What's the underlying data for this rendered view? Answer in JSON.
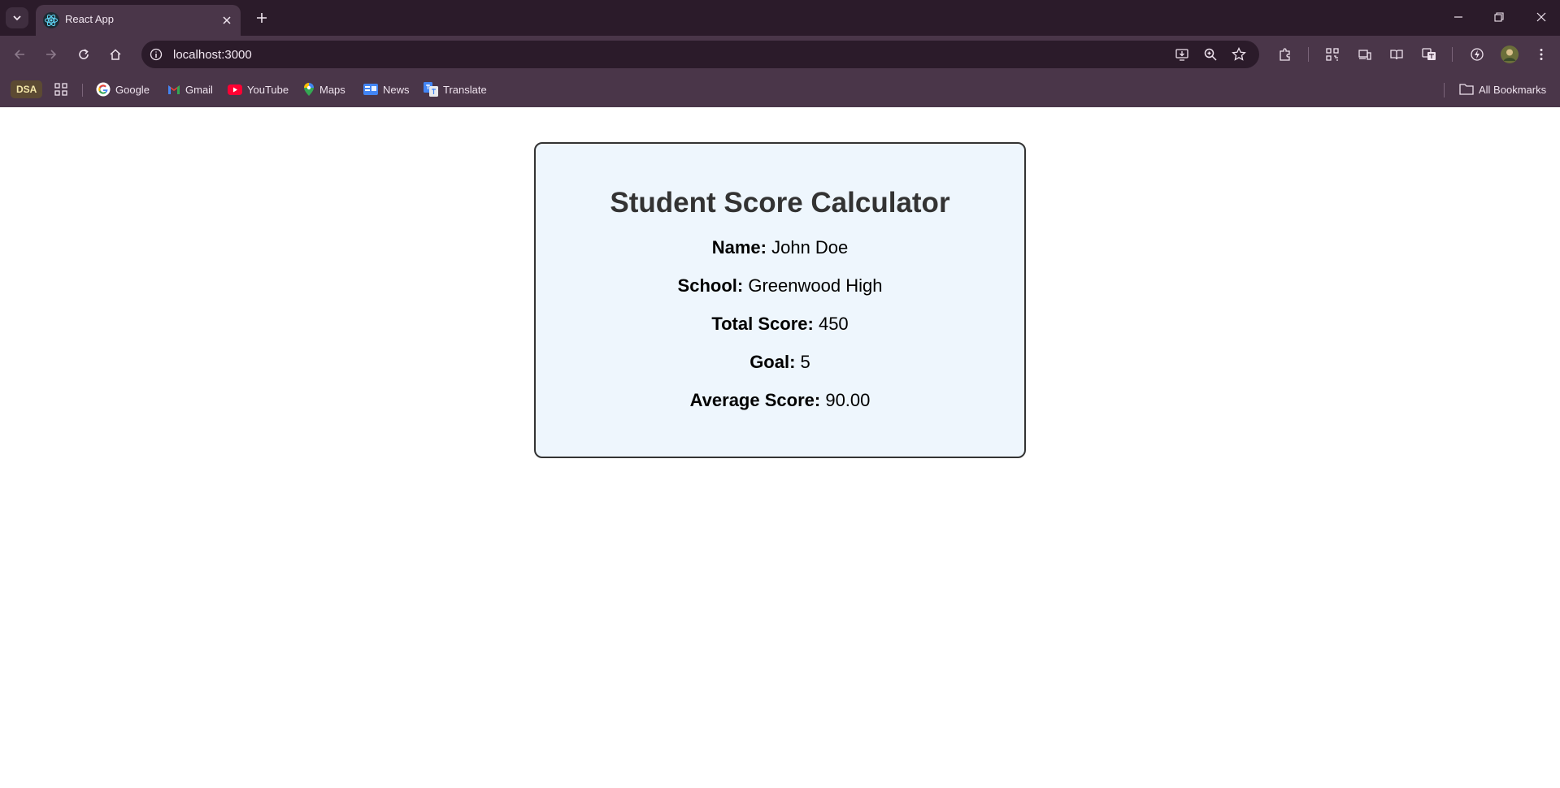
{
  "browser": {
    "tab_title": "React App",
    "url": "localhost:3000",
    "bookmarks": [
      {
        "label": "DSA",
        "icon": "dsa-badge"
      },
      {
        "label": "Google",
        "icon": "google-icon"
      },
      {
        "label": "Gmail",
        "icon": "gmail-icon"
      },
      {
        "label": "YouTube",
        "icon": "youtube-icon"
      },
      {
        "label": "Maps",
        "icon": "maps-icon"
      },
      {
        "label": "News",
        "icon": "news-icon"
      },
      {
        "label": "Translate",
        "icon": "translate-icon"
      }
    ],
    "all_bookmarks_label": "All Bookmarks"
  },
  "card": {
    "title": "Student Score Calculator",
    "fields": [
      {
        "label": "Name:",
        "value": "John Doe"
      },
      {
        "label": "School:",
        "value": "Greenwood High"
      },
      {
        "label": "Total Score:",
        "value": "450"
      },
      {
        "label": "Goal:",
        "value": "5"
      },
      {
        "label": "Average Score:",
        "value": "90.00"
      }
    ]
  },
  "colors": {
    "chrome_dark": "#2b1b2a",
    "chrome_toolbar": "#4a3649",
    "card_background": "#eef6fd",
    "card_border": "#333333"
  }
}
